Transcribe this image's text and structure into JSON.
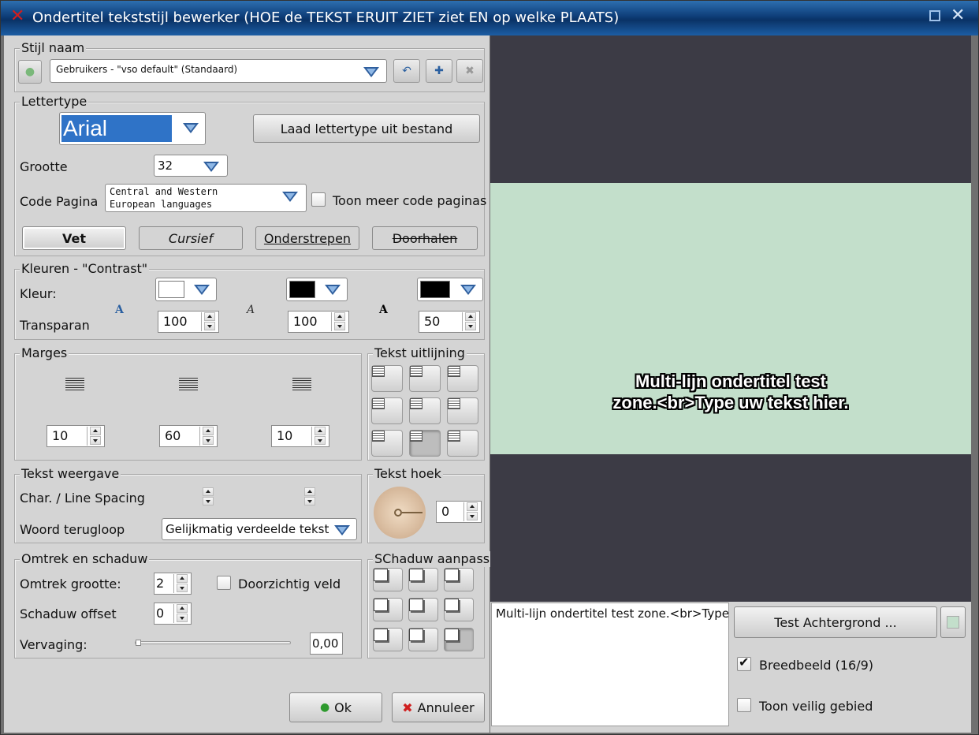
{
  "window": {
    "title": "Ondertitel tekststijl bewerker  (HOE de TEKST ERUIT ZIET ziet EN op welke PLAATS)"
  },
  "style_name": {
    "legend": "Stijl naam",
    "value": "Gebruikers - \"vso default\" (Standaard)"
  },
  "font": {
    "legend": "Lettertype",
    "name": "Arial",
    "load_button": "Laad lettertype uit bestand",
    "size_label": "Grootte",
    "size": "32",
    "codepage_label": "Code Pagina",
    "codepage_line1": "Central and Western",
    "codepage_line2": "European languages",
    "more_codepages": "Toon meer code paginas",
    "bold": "Vet",
    "italic": "Cursief",
    "underline": "Onderstrepen",
    "strike": "Doorhalen"
  },
  "colors": {
    "legend": "Kleuren - \"Contrast\"",
    "color_label": "Kleur:",
    "transp_label": "Transparan",
    "swatches": [
      "#ffffff",
      "#000000",
      "#000000"
    ],
    "transparency": [
      "100",
      "100",
      "50"
    ]
  },
  "margins": {
    "legend": "Marges",
    "values": [
      "10",
      "60",
      "10"
    ]
  },
  "alignment": {
    "legend": "Tekst uitlijning",
    "selected": "bottom-center"
  },
  "text_display": {
    "legend": "Tekst weergave",
    "spacing_label": "Char. / Line Spacing",
    "wrap_label": "Woord terugloop",
    "wrap_value": "Gelijkmatig verdeelde tekst"
  },
  "angle": {
    "legend": "Tekst hoek",
    "value": "0"
  },
  "outline": {
    "legend": "Omtrek en schaduw",
    "size_label": "Omtrek grootte:",
    "size": "2",
    "transparent_field": "Doorzichtig veld",
    "shadow_label": "Schaduw offset",
    "shadow": "0",
    "blur_label": "Vervaging:",
    "blur": "0,00",
    "blur_level": 0
  },
  "shadow_adjust": {
    "legend": "SChaduw aanpasse",
    "selected": "bottom-right"
  },
  "actions": {
    "ok": "Ok",
    "cancel": "Annuleer"
  },
  "preview": {
    "line1": "Multi-lijn ondertitel test",
    "line2": "zone.<br>Type uw tekst hier.",
    "input_text": "Multi-lijn ondertitel test zone.<br>Type uw tekst hier.",
    "test_bg_button": "Test Achtergrond ...",
    "widescreen": "Breedbeeld (16/9)",
    "widescreen_checked": true,
    "safe_area": "Toon veilig gebied",
    "safe_area_checked": false
  }
}
